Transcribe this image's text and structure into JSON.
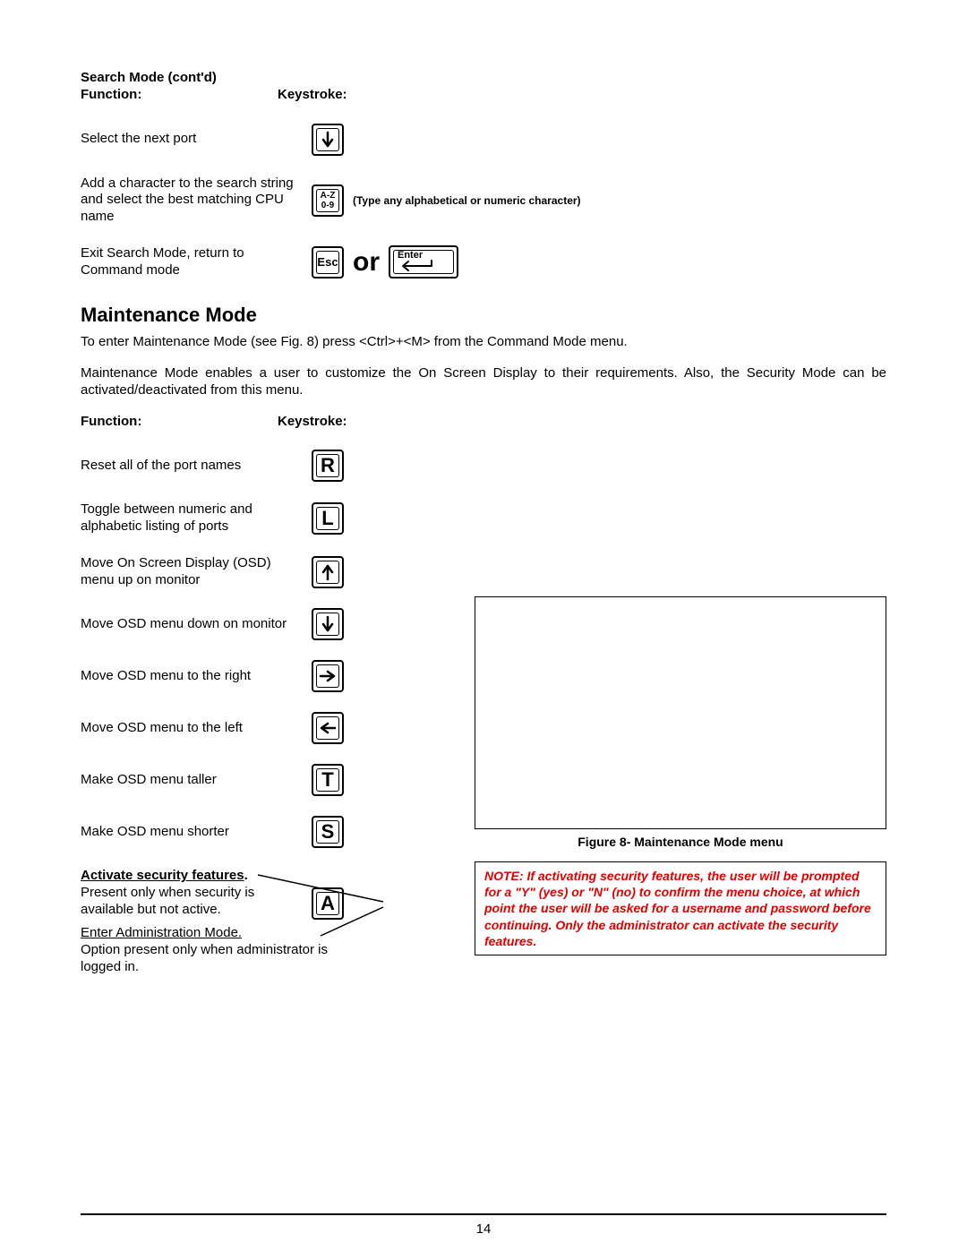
{
  "searchMode": {
    "heading1": "Search Mode (cont'd)",
    "funcHeader": "Function:",
    "keyHeader": "Keystroke:",
    "rows": {
      "nextPort": {
        "fn": "Select the next port"
      },
      "addChar": {
        "fn": "Add a character to the search string and select the best matching CPU name",
        "keyTop": "A-Z",
        "keyBottom": "0-9",
        "note": "(Type any alphabetical or numeric character)"
      },
      "exit": {
        "fn": "Exit Search Mode, return to Command mode",
        "escLabel": "Esc",
        "orLabel": "or",
        "enterLabel": "Enter"
      }
    }
  },
  "maint": {
    "heading": "Maintenance Mode",
    "intro": "To enter Maintenance Mode (see Fig. 8) press <Ctrl>+<M> from the Command Mode menu.",
    "desc": "Maintenance Mode enables a user to customize the On Screen Display to their requirements. Also, the Security Mode can be activated/deactivated from this menu.",
    "funcHeader": "Function:",
    "keyHeader": "Keystroke:",
    "rows": {
      "reset": {
        "fn": "Reset all of the port names",
        "key": "R"
      },
      "toggle": {
        "fn": "Toggle between numeric and alphabetic listing of ports",
        "key": "L"
      },
      "moveUp": {
        "fn": "Move On Screen Display (OSD) menu up on monitor"
      },
      "moveDn": {
        "fn": "Move OSD menu down on monitor"
      },
      "moveRt": {
        "fn": "Move OSD menu to the right"
      },
      "moveLt": {
        "fn": "Move OSD menu to the left"
      },
      "taller": {
        "fn": "Make OSD menu taller",
        "key": "T"
      },
      "shorter": {
        "fn": "Make OSD menu shorter",
        "key": "S"
      },
      "security": {
        "label": "Activate security features",
        "dot": ".",
        "desc": "Present only when security is available but not active.",
        "key": "A"
      },
      "admin": {
        "label": "Enter Administration Mode.",
        "desc": "Option present only when administrator is logged in."
      }
    }
  },
  "figure": {
    "caption": "Figure 8- Maintenance Mode menu",
    "note": "NOTE: If activating security features, the user will be prompted for a \"Y\" (yes) or \"N\" (no) to confirm the menu choice, at which point the user will be asked for a username and password before continuing. Only the administrator can activate the security features."
  },
  "pageNumber": "14"
}
